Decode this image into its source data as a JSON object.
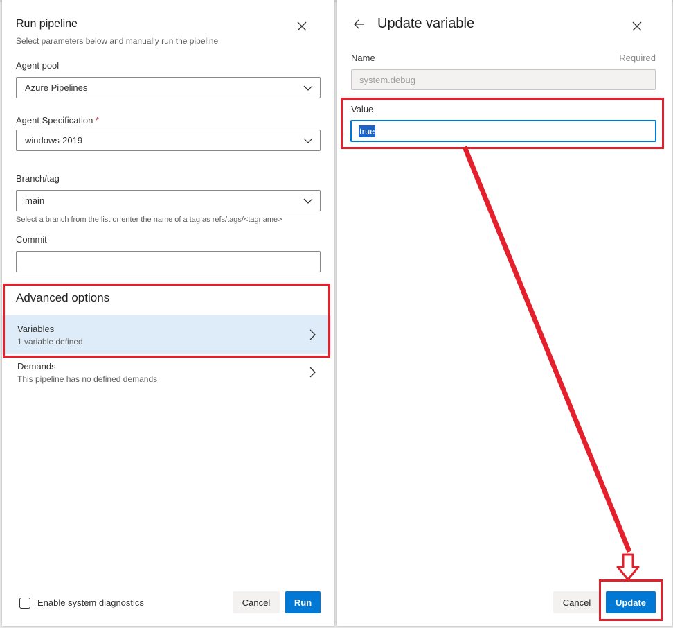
{
  "run_pipeline": {
    "title": "Run pipeline",
    "subtitle": "Select parameters below and manually run the pipeline",
    "agent_pool": {
      "label": "Agent pool",
      "value": "Azure Pipelines"
    },
    "agent_spec": {
      "label": "Agent Specification",
      "required_marker": "*",
      "value": "windows-2019"
    },
    "branch": {
      "label": "Branch/tag",
      "value": "main",
      "hint": "Select a branch from the list or enter the name of a tag as refs/tags/<tagname>"
    },
    "commit": {
      "label": "Commit",
      "value": ""
    },
    "advanced_options": "Advanced options",
    "rows": [
      {
        "title": "Variables",
        "subtitle": "1 variable defined"
      },
      {
        "title": "Demands",
        "subtitle": "This pipeline has no defined demands"
      }
    ],
    "diagnostics_label": "Enable system diagnostics",
    "cancel_label": "Cancel",
    "run_label": "Run"
  },
  "update_variable": {
    "title": "Update variable",
    "name_label": "Name",
    "required_label": "Required",
    "name_value": "system.debug",
    "value_label": "Value",
    "value_value": "true",
    "cancel_label": "Cancel",
    "update_label": "Update"
  },
  "colors": {
    "primary": "#0078d4",
    "selected_row": "#deecf9",
    "annotation_red": "#e3202b"
  },
  "icons": [
    "close-icon",
    "chevron-down-icon",
    "chevron-right-icon",
    "back-arrow-icon",
    "down-arrow-annotation-icon"
  ]
}
